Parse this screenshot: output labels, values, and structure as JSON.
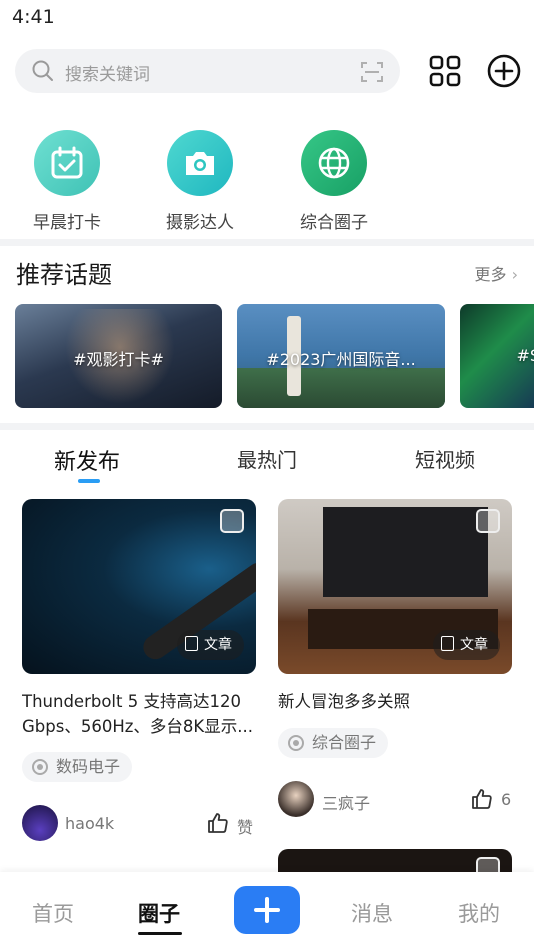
{
  "status": {
    "time": "4:41"
  },
  "search": {
    "placeholder": "搜索关键词"
  },
  "shortcuts": [
    {
      "label": "早晨打卡",
      "icon": "calendar-check-icon",
      "color": "#4fd1c5"
    },
    {
      "label": "摄影达人",
      "icon": "camera-icon",
      "color": "#2cc6c0"
    },
    {
      "label": "综合圈子",
      "icon": "globe-icon",
      "color": "#2bb673"
    }
  ],
  "topics": {
    "title": "推荐话题",
    "more": "更多",
    "items": [
      {
        "label": "#观影打卡#"
      },
      {
        "label": "#2023广州国际音..."
      },
      {
        "label": "#S"
      }
    ]
  },
  "feed_tabs": [
    {
      "label": "新发布",
      "active": true
    },
    {
      "label": "最热门",
      "active": false
    },
    {
      "label": "短视频",
      "active": false
    }
  ],
  "posts": [
    {
      "badge": "文章",
      "title": "Thunderbolt 5 支持高达120 Gbps、560Hz、多台8K显示...",
      "circle": "数码电子",
      "user": "hao4k",
      "likes": "赞"
    },
    {
      "badge": "文章",
      "title": "新人冒泡多多关照",
      "circle": "综合圈子",
      "user": "三疯子",
      "likes": "6"
    }
  ],
  "bottom_nav": [
    {
      "label": "首页",
      "active": false
    },
    {
      "label": "圈子",
      "active": true
    },
    {
      "label": "消息",
      "active": false
    },
    {
      "label": "我的",
      "active": false
    }
  ],
  "colors": {
    "accent": "#2a7df4",
    "tab_indicator": "#2a9df4"
  }
}
